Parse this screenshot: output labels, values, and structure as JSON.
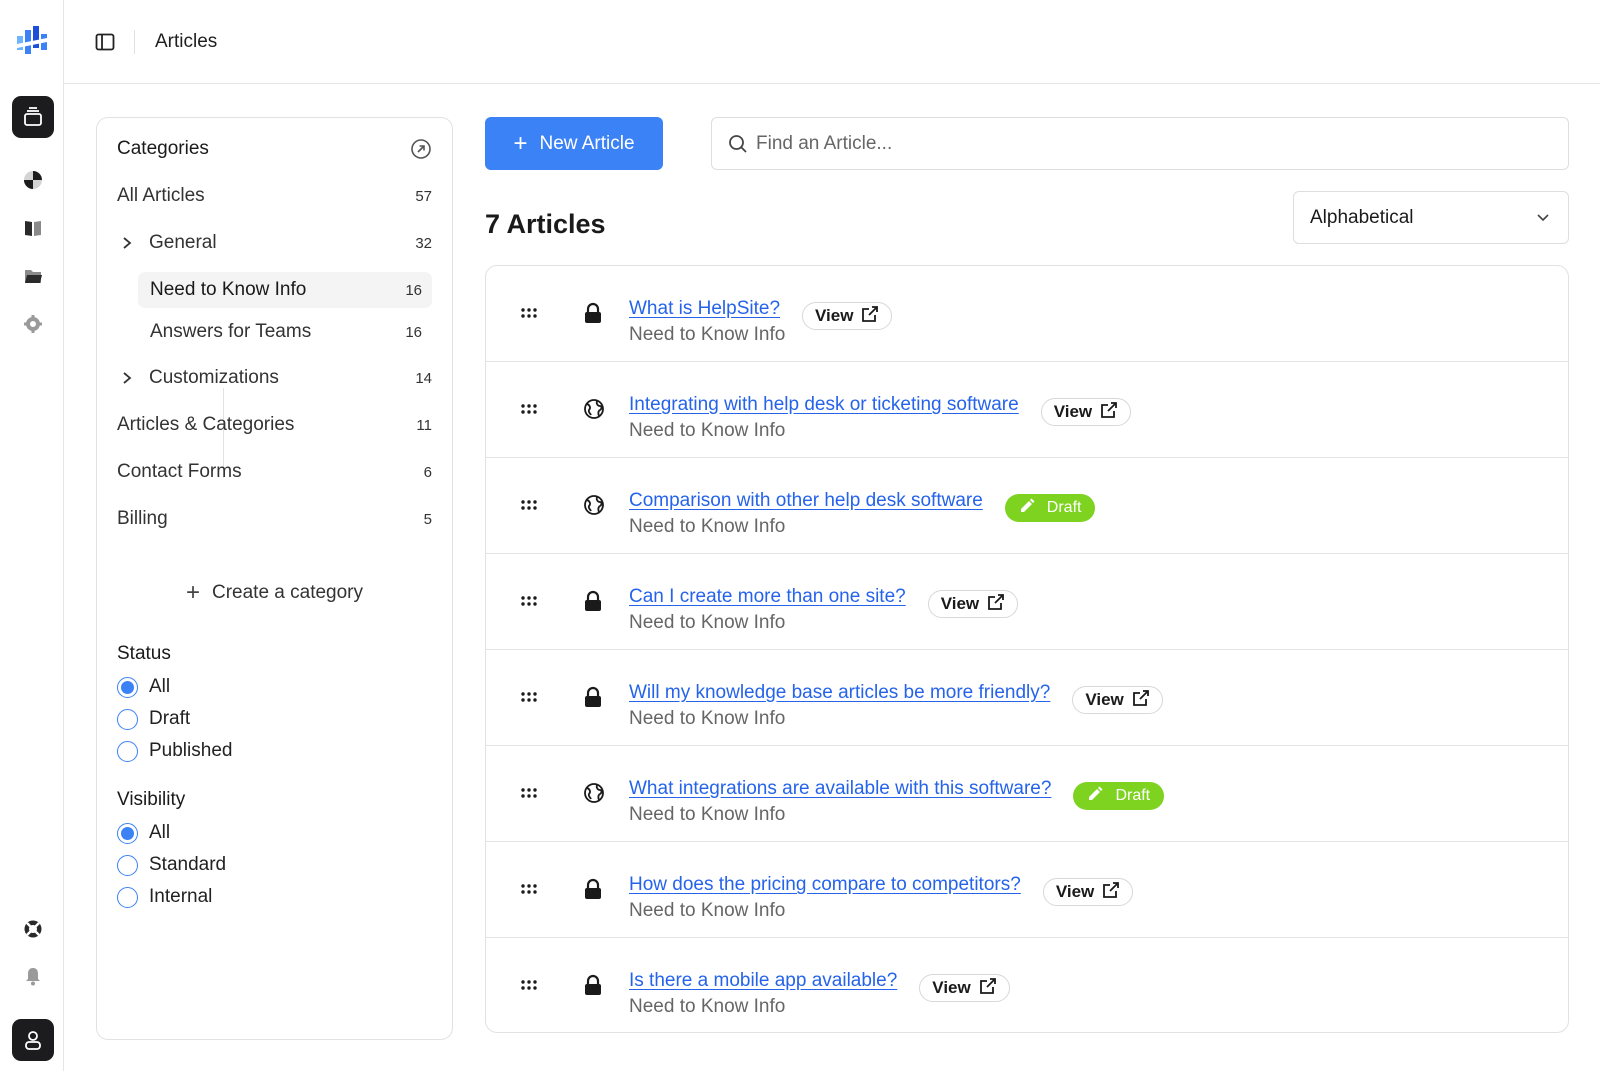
{
  "header": {
    "title": "Articles"
  },
  "categories": {
    "heading": "Categories",
    "items": [
      {
        "label": "All Articles",
        "count": "57"
      },
      {
        "label": "General",
        "count": "32"
      },
      {
        "label": "Need to Know Info",
        "count": "16"
      },
      {
        "label": "Answers for Teams",
        "count": "16"
      },
      {
        "label": "Customizations",
        "count": "14"
      },
      {
        "label": "Articles & Categories",
        "count": "11"
      },
      {
        "label": "Contact Forms",
        "count": "6"
      },
      {
        "label": "Billing",
        "count": "5"
      }
    ],
    "create_label": "Create a category"
  },
  "filters": {
    "status": {
      "title": "Status",
      "options": [
        "All",
        "Draft",
        "Published"
      ],
      "selected": "All"
    },
    "visibility": {
      "title": "Visibility",
      "options": [
        "All",
        "Standard",
        "Internal"
      ],
      "selected": "All"
    }
  },
  "toolbar": {
    "new_label": "New Article",
    "search_placeholder": "Find an Article...",
    "count_label": "7 Articles",
    "sort_value": "Alphabetical"
  },
  "articles": [
    {
      "title": "What is HelpSite?",
      "category": "Need to Know Info",
      "visibility": "lock-icon",
      "badge": "View"
    },
    {
      "title": "Integrating with help desk or ticketing software",
      "category": "Need to Know Info",
      "visibility": "globe-icon",
      "badge": "View"
    },
    {
      "title": "Comparison with other help desk software",
      "category": "Need to Know Info",
      "visibility": "globe-icon",
      "badge": "Draft"
    },
    {
      "title": "Can I create more than one site?",
      "category": "Need to Know Info",
      "visibility": "lock-icon",
      "badge": "View"
    },
    {
      "title": "Will my knowledge base articles be more friendly?",
      "category": "Need to Know Info",
      "visibility": "lock-icon",
      "badge": "View"
    },
    {
      "title": "What integrations are available with this software?",
      "category": "Need to Know Info",
      "visibility": "globe-icon",
      "badge": "Draft"
    },
    {
      "title": "How does the pricing compare to competitors?",
      "category": "Need to Know Info",
      "visibility": "lock-icon",
      "badge": "View"
    },
    {
      "title": "Is there a mobile app available?",
      "category": "Need to Know Info",
      "visibility": "lock-icon",
      "badge": "View"
    }
  ],
  "colors": {
    "accent": "#3b82f6",
    "link": "#2563eb",
    "draft": "#7ed321",
    "rail_active": "#1c1c1e"
  },
  "icons": [
    "logo-icon",
    "articles-icon",
    "pie-chart-icon",
    "book-icon",
    "folder-icon",
    "gear-icon",
    "lifebuoy-icon",
    "bell-icon",
    "user-icon",
    "sidebar-toggle-icon",
    "external-link-icon",
    "search-icon",
    "chevron-down-icon",
    "drag-handle-icon",
    "lock-icon",
    "globe-icon",
    "pencil-icon"
  ]
}
